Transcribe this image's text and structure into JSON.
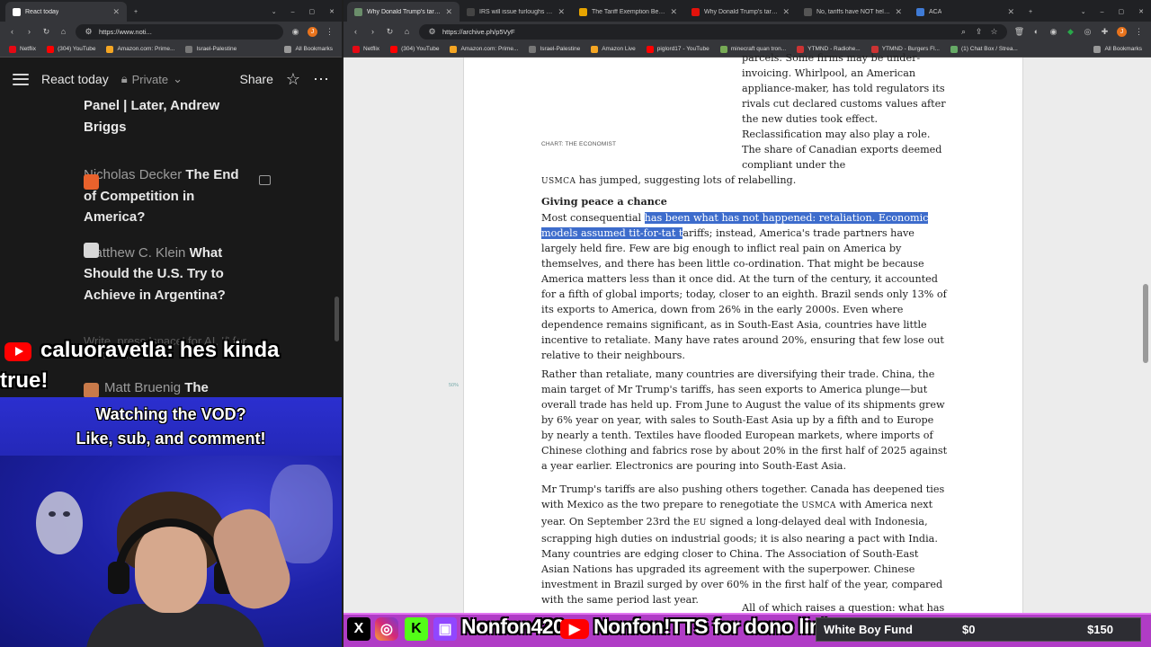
{
  "left_browser": {
    "tab": {
      "title": "React today"
    },
    "url": "https://www.noti...",
    "bookmarks": [
      "Netflix",
      "(304) YouTube",
      "Amazon.com: Prime...",
      "Israel-Palestine",
      "All Bookmarks"
    ]
  },
  "notion": {
    "page_title": "React today",
    "privacy": "Private",
    "share_label": "Share",
    "feed": [
      {
        "text_bold_tail": "Panel | Later, Andrew Briggs"
      },
      {
        "author": "Nicholas Decker",
        "title": "The End of Competition in America?"
      },
      {
        "author": "Matthew C. Klein",
        "title": "What Should the U.S. Try to Achieve in Argentina?"
      },
      {
        "author": "Matt Bruenig",
        "title": "The"
      }
    ],
    "faint_hint": "Write, press 'space' for AI, '/' for commands..."
  },
  "chat": {
    "username": "caluoravetla:",
    "message_part1": "hes kinda",
    "message_part2": "true!"
  },
  "vod_banner": {
    "line1": "Watching the VOD?",
    "line2": "Like, sub, and comment!"
  },
  "right_browser": {
    "tabs": [
      {
        "title": "Why Donald Trump's tariffs a",
        "color": "#6b8e6b",
        "active": true
      },
      {
        "title": "IRS will issue furloughs as go",
        "color": "#444"
      },
      {
        "title": "The Tariff Exemption Behind",
        "color": "#e6a400"
      },
      {
        "title": "Why Donald Trump's tariffs h",
        "color": "#e3120b"
      },
      {
        "title": "No, tariffs have NOT helped",
        "color": "#555"
      },
      {
        "title": "ACA",
        "color": "#3f7bd6"
      }
    ],
    "url": "https://archive.ph/p5VyF",
    "bookmarks": [
      "Netflix",
      "(304) YouTube",
      "Amazon.com: Prime...",
      "Israel-Palestine",
      "Amazon Live",
      "piglord17 - YouTube",
      "minecraft quan tron...",
      "YTMND - Radiohe...",
      "YTMND - Burgers Fl...",
      "(1) Chat Box / Strea...",
      "All Bookmarks"
    ]
  },
  "article": {
    "col_top": "parcels. Some firms may be under-invoicing. Whirlpool, an American appliance-maker, has told regulators its rivals cut declared customs values after the new duties took effect. Reclassification may also play a role. The share of Canadian exports deemed compliant under the",
    "chart_credit": "CHART: THE ECONOMIST",
    "usmca_abbr": "USMCA",
    "usmca_rest": " has jumped, suggesting lots of relabelling.",
    "heading": "Giving peace a chance",
    "p1_lead": "Most consequential ",
    "p1_highlight": "has been what has not happened: retaliation. Economic models assumed tit-for-tat t",
    "p1_rest": "ariffs; instead, America's trade partners have largely held fire. Few are big enough to inflict real pain on America by themselves, and there has been little co-ordination. That might be because America matters less than it once did. At the turn of the century, it accounted for a fifth of global imports; today, closer to an eighth. Brazil sends only 13% of its exports to America, down from 26% in the early 2000s. Even where dependence remains significant, as in South-East Asia, countries have little incentive to retaliate. Many have rates around 20%, ensuring that few lose out relative to their neighbours.",
    "p2": "Rather than retaliate, many countries are diversifying their trade. China, the main target of Mr Trump's tariffs, has seen exports to America plunge—but overall trade has held up. From June to August the value of its shipments grew by 6% year on year, with sales to South-East Asia up by a fifth and to Europe by nearly a tenth. Textiles have flooded European markets, where imports of Chinese clothing and fabrics rose by about 20% in the first half of 2025 against a year earlier. Electronics are pouring into South-East Asia.",
    "p3_a": "Mr Trump's tariffs are also pushing others together. Canada has deepened ties with Mexico as the two prepare to renegotiate the ",
    "p3_usmca": "USMCA",
    "p3_b": " with America next year. On September 23rd the ",
    "p3_eu": "EU",
    "p3_c": " signed a long-delayed deal with Indonesia, scrapping high duties on industrial goods; it is also nearing a pact with India. Many countries are edging closer to China. The Association of South-East Asian Nations has upgraded its agreement with the superpower. Chinese investment in Brazil surged by over 60% in the first half of the year, compared with the same period last year.",
    "tail": "All of which raises a question: what has",
    "gutter_mark": "50%"
  },
  "overlay": {
    "x_glyph": "X",
    "kick_glyph": "K",
    "handle": "Nonfon420",
    "yt_name": "Nonfon",
    "tts": "!TTS for dono link",
    "fund_name": "White Boy Fund",
    "fund_amount": "$0",
    "fund_goal": "$150"
  }
}
